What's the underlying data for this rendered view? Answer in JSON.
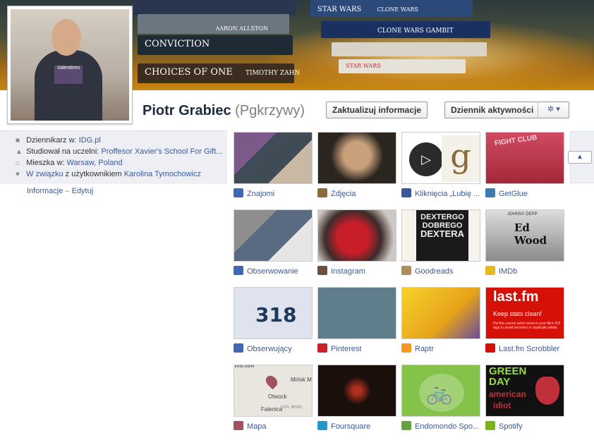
{
  "cover": {
    "books": [
      "CONVICTION",
      "CHOICES OF ONE",
      "TIMOTHY ZAHN",
      "AARON ALLSTON",
      "STAR WARS",
      "CLONE WARS GAMBIT",
      "CLONE WARS",
      "STAR WARS"
    ]
  },
  "profile": {
    "name": "Piotr Grabiec",
    "alt_name": "(Pgkrzywy)",
    "shirt_text": "Valentines",
    "update_button": "Zaktualizuj informacje",
    "activity_button": "Dziennik aktywności",
    "gear_glyph": "✲ ▾"
  },
  "info": {
    "rows": [
      {
        "icon": "briefcase-icon",
        "glyph": "■",
        "prefix": "Dziennikarz w: ",
        "link": "IDG.pl"
      },
      {
        "icon": "school-icon",
        "glyph": "▲",
        "prefix": "Studiował na uczelni: ",
        "link": "Proffesor Xavier's School For Gift..."
      },
      {
        "icon": "home-icon",
        "glyph": "⌂",
        "prefix": "Mieszka w: ",
        "link": "Warsaw, Poland"
      },
      {
        "icon": "heart-icon",
        "glyph": "♥",
        "prefix": "",
        "link": "W związku",
        "suffix": " z użytkownikiem ",
        "link2": "Karolina Tymochowicz"
      }
    ],
    "info_link": "Informacje",
    "separator": " – ",
    "edit_link": "Edytuj"
  },
  "tiles": [
    {
      "label": "Znajomi",
      "icon": "friends-icon",
      "color": "#4267b2"
    },
    {
      "label": "Zdjęcia",
      "icon": "photos-icon",
      "color": "#8b6d3a"
    },
    {
      "label": "Kliknięcia „Lubię ...",
      "icon": "like-icon",
      "color": "#3b5998"
    },
    {
      "label": "GetGlue",
      "icon": "getglue-icon",
      "color": "#3c7ab8"
    },
    {
      "label": "Obserwowanie",
      "icon": "rss-icon",
      "color": "#4267b2"
    },
    {
      "label": "Instagram",
      "icon": "instagram-icon",
      "color": "#6b5040"
    },
    {
      "label": "Goodreads",
      "icon": "goodreads-icon",
      "color": "#b08d57"
    },
    {
      "label": "IMDb",
      "icon": "imdb-icon",
      "color": "#e6b91e"
    },
    {
      "label": "Obserwujący",
      "icon": "followers-icon",
      "color": "#4267b2",
      "count": "318"
    },
    {
      "label": "Pinterest",
      "icon": "pinterest-icon",
      "color": "#cb2027"
    },
    {
      "label": "Raptr",
      "icon": "raptr-icon",
      "color": "#f39a1e"
    },
    {
      "label": "Last.fm Scrobbler",
      "icon": "lastfm-icon",
      "color": "#d51007"
    },
    {
      "label": "Mapa",
      "icon": "map-pin-icon",
      "color": "#a0525f",
      "map_labels": [
        "Warsaw",
        "Mińsk M",
        "Otwock",
        "Falenica",
        "rcin-Jezio"
      ]
    },
    {
      "label": "Foursquare",
      "icon": "foursquare-icon",
      "color": "#2398c9"
    },
    {
      "label": "Endomondo Spo...",
      "icon": "endomondo-icon",
      "color": "#65a33b"
    },
    {
      "label": "Spotify",
      "icon": "spotify-icon",
      "color": "#7ab317"
    }
  ],
  "lastfm_thumb": {
    "logo": "last.fm",
    "headline": "Keep stats clean!",
    "body": "Put the correct artist name in your file's ID3 tags to avoid incorrect or duplicate artists"
  },
  "dexter_thumb": {
    "line1": "DEXTERGO",
    "line2": "DOBREGO",
    "line3": "DEXTERA"
  },
  "edwood_thumb": {
    "actor": "JOHNNY DEPP",
    "title": "Ed Wood"
  },
  "greenday_thumb": {
    "line1": "GREEN",
    "line2": "DAY",
    "line3": "american",
    "line4": "idiot"
  },
  "getglue_thumb": {
    "text": "FIGHT CLUB"
  },
  "up_glyph": "▲"
}
